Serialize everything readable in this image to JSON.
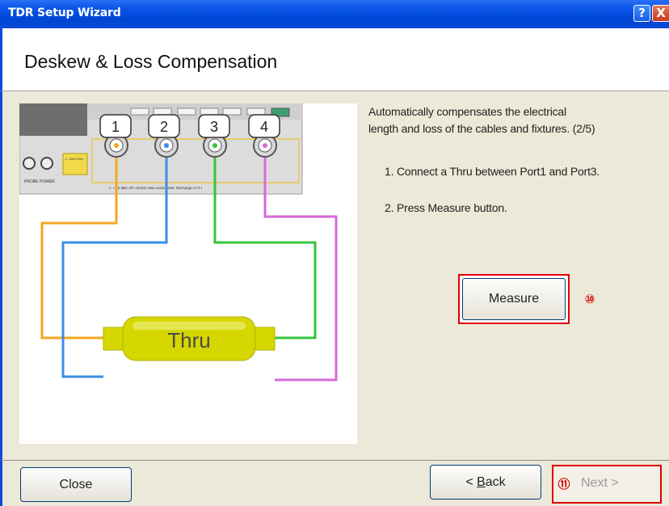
{
  "window": {
    "title": "TDR Setup Wizard",
    "help_glyph": "?",
    "close_glyph": "X"
  },
  "header": {
    "title": "Deskew & Loss Compensation"
  },
  "illustration": {
    "ports": [
      "1",
      "2",
      "3",
      "4"
    ],
    "thru_label": "Thru",
    "panel_text": {
      "probe_power": "PROBE POWER",
      "caution": "⚠ CAUTION",
      "rating": "⚠ +-20 dBm  RF  ±5VDC Max   Avoid Static Discharge CAT I"
    },
    "cable_colors": {
      "port1": "#f5a623",
      "port2": "#3a8ee6",
      "port3": "#34c43a",
      "port4": "#d56ad8"
    },
    "thru_color": "#d6d600"
  },
  "instructions": {
    "description_line1": "Automatically compensates the electrical",
    "description_line2": "length and loss of the cables and fixtures.  (2/5)",
    "step1": "1. Connect a Thru between Port1 and Port3.",
    "step2": "2. Press Measure button."
  },
  "buttons": {
    "measure": "Measure",
    "close": "Close",
    "back": "< Back",
    "back_prefix": "< ",
    "back_accel": "B",
    "back_rest": "ack",
    "next": "Next >"
  },
  "callouts": {
    "measure": "⑩",
    "next": "⑪"
  }
}
